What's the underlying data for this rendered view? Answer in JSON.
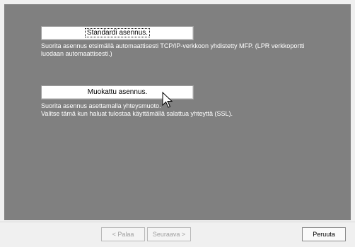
{
  "options": [
    {
      "button_label": "Standardi asennus.",
      "description": "Suorita asennus etsimällä automaattisesti TCP/IP-verkkoon yhdistetty MFP.  (LPR verkkoportti\nluodaan automaattisesti.)"
    },
    {
      "button_label": "Muokattu asennus.",
      "description": "Suorita asennus asettamalla yhteysmuoto.\nValitse tämä kun haluat tulostaa käyttämällä salattua yhteyttä (SSL)."
    }
  ],
  "navigation": {
    "back_label": "< Palaa",
    "next_label": "Seuraava >",
    "cancel_label": "Peruuta"
  },
  "colors": {
    "panel": "#808080",
    "window": "#f0f0f0",
    "description_text": "#ffffff"
  },
  "cursor_icon": "arrow-pointer-icon"
}
